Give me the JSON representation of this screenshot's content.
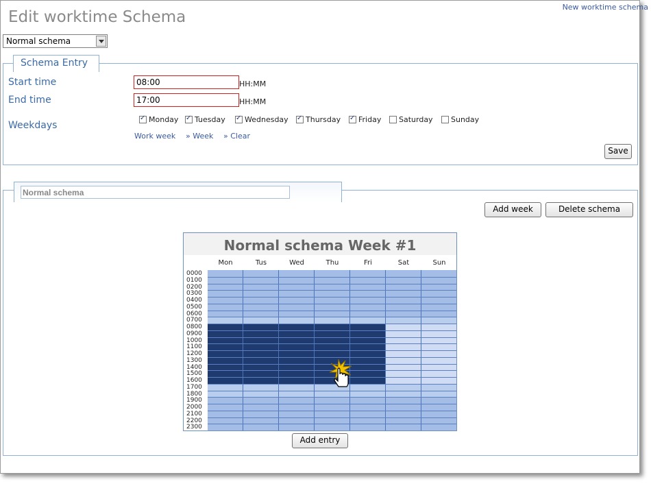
{
  "header": {
    "title": "Edit worktime Schema",
    "new_link": "New worktime schema"
  },
  "schema_select": {
    "value": "Normal schema"
  },
  "entry": {
    "tab_label": "Schema Entry",
    "start_label": "Start time",
    "start_value": "08:00",
    "end_label": "End time",
    "end_value": "17:00",
    "time_hint": "HH:MM",
    "weekdays_label": "Weekdays",
    "days": [
      {
        "label": "Monday",
        "checked": true
      },
      {
        "label": "Tuesday",
        "checked": true
      },
      {
        "label": "Wednesday",
        "checked": true
      },
      {
        "label": "Thursday",
        "checked": true
      },
      {
        "label": "Friday",
        "checked": true
      },
      {
        "label": "Saturday",
        "checked": false
      },
      {
        "label": "Sunday",
        "checked": false
      }
    ],
    "links": [
      "Work week",
      "» Week",
      "» Clear"
    ],
    "save_label": "Save"
  },
  "schema": {
    "name_value": "Normal schema",
    "add_week_label": "Add week",
    "delete_label": "Delete schema",
    "add_entry_label": "Add entry"
  },
  "calendar": {
    "title": "Normal schema Week #1",
    "day_names": [
      "Mon",
      "Tus",
      "Wed",
      "Thu",
      "Fri",
      "Sat",
      "Sun"
    ],
    "hours": [
      "0000",
      "0100",
      "0200",
      "0300",
      "0400",
      "0500",
      "0600",
      "0700",
      "0800",
      "0900",
      "1000",
      "1100",
      "1200",
      "1300",
      "1400",
      "1500",
      "1600",
      "1700",
      "1800",
      "1900",
      "2000",
      "2100",
      "2200",
      "2300"
    ],
    "selected_days": [
      "Mon",
      "Tus",
      "Wed",
      "Thu",
      "Fri"
    ],
    "selected_from": "0800",
    "selected_to": "1600",
    "colors": {
      "selected": "#1e3a6e",
      "weekday": "#a4bde6",
      "weekend": "#cfdcf3",
      "weekend_night": "#a4bde6"
    }
  }
}
